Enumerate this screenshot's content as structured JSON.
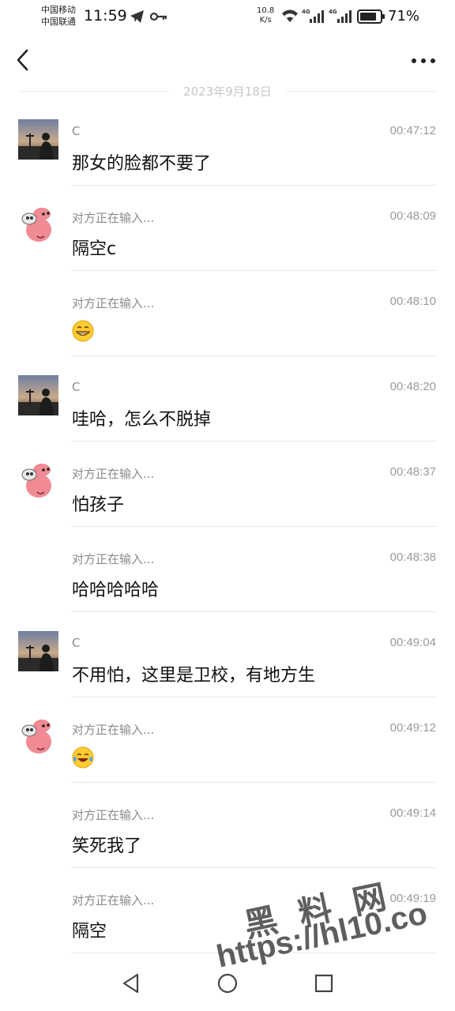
{
  "status_bar": {
    "carrier_1": "中国移动",
    "carrier_2": "中国联通",
    "time": "11:59",
    "net_speed_value": "10.8",
    "net_speed_unit": "K/s",
    "battery": "71%",
    "icons": [
      "telegram-icon",
      "key-icon",
      "wifi-icon",
      "signal-4g-icon",
      "signal-4g-icon",
      "battery-icon"
    ]
  },
  "nav": {
    "back_icon": "chevron-left-icon",
    "more_icon": "more-dots-icon"
  },
  "date_divider": "2023年9月18日",
  "messages": [
    {
      "sender": "C",
      "time": "00:47:12",
      "text": "那女的脸都不要了",
      "avatar": "c",
      "emoji": ""
    },
    {
      "sender": "对方正在输入...",
      "time": "00:48:09",
      "text": "隔空c",
      "avatar": "pink",
      "emoji": ""
    },
    {
      "sender": "对方正在输入...",
      "time": "00:48:10",
      "text": "",
      "avatar": "",
      "emoji": "grin"
    },
    {
      "sender": "C",
      "time": "00:48:20",
      "text": "哇哈，怎么不脱掉",
      "avatar": "c",
      "emoji": ""
    },
    {
      "sender": "对方正在输入...",
      "time": "00:48:37",
      "text": "怕孩子",
      "avatar": "pink",
      "emoji": ""
    },
    {
      "sender": "对方正在输入...",
      "time": "00:48:38",
      "text": "哈哈哈哈哈",
      "avatar": "",
      "emoji": ""
    },
    {
      "sender": "C",
      "time": "00:49:04",
      "text": "不用怕，这里是卫校，有地方生",
      "avatar": "c",
      "emoji": ""
    },
    {
      "sender": "对方正在输入...",
      "time": "00:49:12",
      "text": "",
      "avatar": "pink",
      "emoji": "tears-of-joy"
    },
    {
      "sender": "对方正在输入...",
      "time": "00:49:14",
      "text": "笑死我了",
      "avatar": "",
      "emoji": ""
    },
    {
      "sender": "对方正在输入...",
      "time": "00:49:19",
      "text": "隔空",
      "avatar": "",
      "emoji": ""
    }
  ],
  "watermark": {
    "line1": "黑料网",
    "line2": "https://hl10.co"
  },
  "system_nav": {
    "back_icon": "triangle-back-icon",
    "home_icon": "circle-home-icon",
    "recents_icon": "square-recents-icon"
  }
}
